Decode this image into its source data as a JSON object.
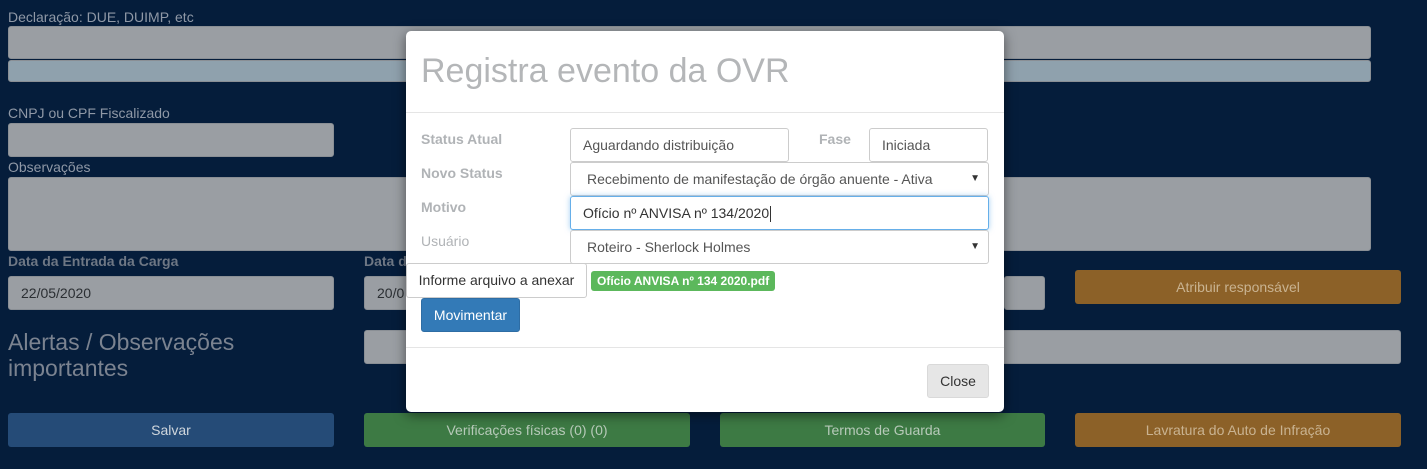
{
  "background": {
    "declaracao_label": "Declaração: DUE, DUIMP, etc",
    "cnpj_label": "CNPJ ou CPF Fiscalizado",
    "observacoes_label": "Observações",
    "data_entrada_label": "Data da Entrada da Carga",
    "data_second_label": "Data d",
    "data_entrada_value": "22/05/2020",
    "data_second_value": "20/0",
    "atribuir_label": "Atribuir responsável",
    "alertas_title": "Alertas / Observações importantes",
    "buttons": {
      "salvar": "Salvar",
      "verificacoes": "Verificações físicas (0) (0)",
      "termos": "Termos de Guarda",
      "lavratura": "Lavratura do Auto de Infração"
    }
  },
  "modal": {
    "title": "Registra evento da OVR",
    "status_atual_label": "Status Atual",
    "status_atual_value": "Aguardando distribuição",
    "fase_label": "Fase",
    "fase_value": "Iniciada",
    "novo_status_label": "Novo Status",
    "novo_status_value": "Recebimento de manifestação de órgão anuente - Ativa",
    "motivo_label": "Motivo",
    "motivo_value": "Ofício nº ANVISA nº 134/2020",
    "usuario_label": "Usuário",
    "usuario_value": "Roteiro - Sherlock Holmes",
    "file_button_label": "Informe arquivo a anexar",
    "file_name": "Ofício ANVISA nº 134 2020.pdf",
    "move_button_label": "Movimentar",
    "close_button_label": "Close"
  },
  "colors": {
    "page_background": "#051d3b",
    "primary": "#337ab7",
    "success": "#5cb85c",
    "warning": "#f0ad4e"
  }
}
